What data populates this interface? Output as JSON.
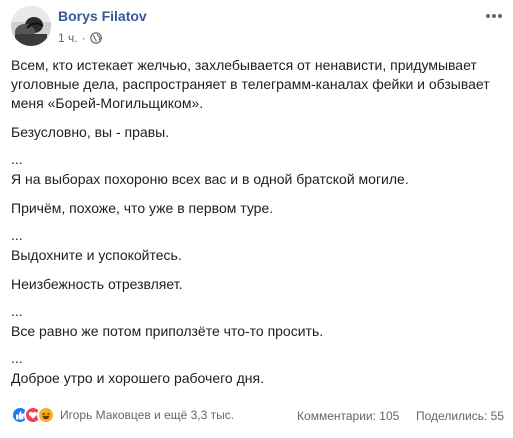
{
  "post": {
    "author": "Borys Filatov",
    "time": "1 ч.",
    "separator": "·",
    "paragraphs": [
      "Всем, кто истекает желчью, захлебывается от ненависти, придумывает уголовные дела, распространяет в телеграмм-каналах фейки и обзывает меня «Борей-Могильщиком».",
      "Безусловно, вы - правы.",
      "...",
      "Я на выборах похороню всех вас и в одной братской могиле.",
      "Причём, похоже, что уже в первом туре.",
      "...",
      "Выдохните и успокойтесь.",
      "Неизбежность отрезвляет.",
      "...",
      "Все равно же потом приползёте что-то просить.",
      "...",
      "Доброе утро и хорошего рабочего дня."
    ]
  },
  "footer": {
    "reactions_text": "Игорь Маковцев и ещё 3,3 тыс.",
    "comments": "Комментарии: 105",
    "shares": "Поделились: 55"
  },
  "colors": {
    "author": "#385898",
    "meta": "#606770",
    "like": "#2078f4",
    "love": "#f33e58",
    "haha": "#f7b125"
  }
}
